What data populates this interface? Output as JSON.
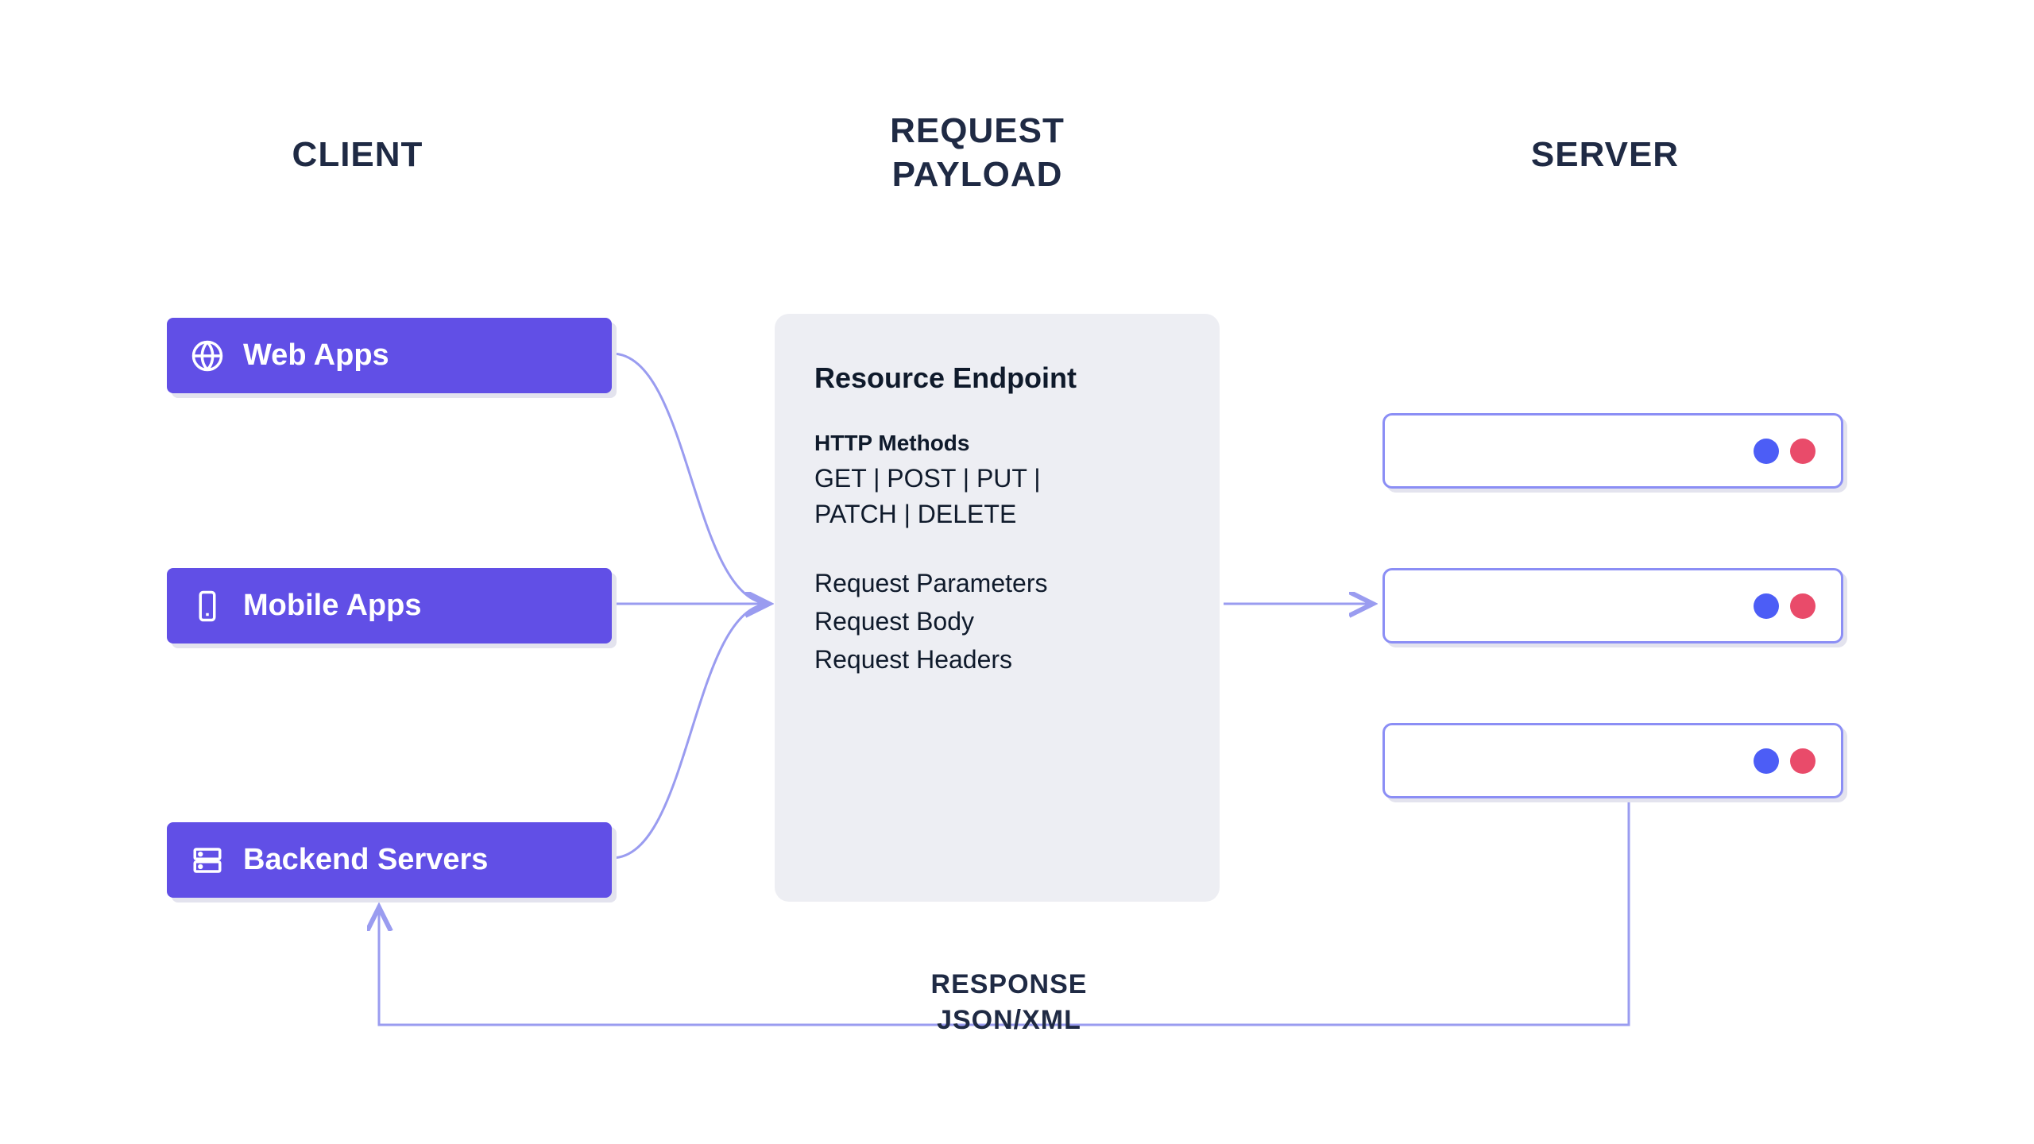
{
  "sections": {
    "client": "CLIENT",
    "payload_line1": "REQUEST",
    "payload_line2": "PAYLOAD",
    "server": "SERVER"
  },
  "clients": [
    {
      "label": "Web Apps",
      "icon": "globe"
    },
    {
      "label": "Mobile Apps",
      "icon": "mobile"
    },
    {
      "label": "Backend Servers",
      "icon": "server"
    }
  ],
  "payload": {
    "title": "Resource Endpoint",
    "methods_label": "HTTP Methods",
    "methods_line1": "GET | POST | PUT |",
    "methods_line2": "PATCH | DELETE",
    "items": [
      "Request Parameters",
      "Request Body",
      "Request Headers"
    ]
  },
  "response": {
    "line1": "RESPONSE",
    "line2": "JSON/XML"
  },
  "colors": {
    "accent": "#614fe6",
    "dark": "#1f2a44",
    "line": "#9a9cf0",
    "dot_blue": "#4c5df6",
    "dot_red": "#e94b6a"
  }
}
